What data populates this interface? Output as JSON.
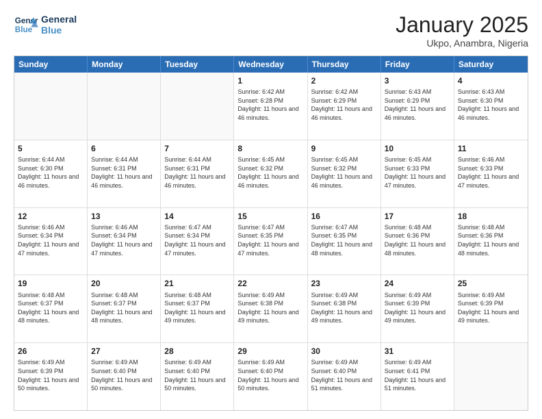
{
  "logo": {
    "line1": "General",
    "line2": "Blue"
  },
  "title": "January 2025",
  "location": "Ukpo, Anambra, Nigeria",
  "days": [
    "Sunday",
    "Monday",
    "Tuesday",
    "Wednesday",
    "Thursday",
    "Friday",
    "Saturday"
  ],
  "weeks": [
    [
      {
        "day": "",
        "info": ""
      },
      {
        "day": "",
        "info": ""
      },
      {
        "day": "",
        "info": ""
      },
      {
        "day": "1",
        "info": "Sunrise: 6:42 AM\nSunset: 6:28 PM\nDaylight: 11 hours and 46 minutes."
      },
      {
        "day": "2",
        "info": "Sunrise: 6:42 AM\nSunset: 6:29 PM\nDaylight: 11 hours and 46 minutes."
      },
      {
        "day": "3",
        "info": "Sunrise: 6:43 AM\nSunset: 6:29 PM\nDaylight: 11 hours and 46 minutes."
      },
      {
        "day": "4",
        "info": "Sunrise: 6:43 AM\nSunset: 6:30 PM\nDaylight: 11 hours and 46 minutes."
      }
    ],
    [
      {
        "day": "5",
        "info": "Sunrise: 6:44 AM\nSunset: 6:30 PM\nDaylight: 11 hours and 46 minutes."
      },
      {
        "day": "6",
        "info": "Sunrise: 6:44 AM\nSunset: 6:31 PM\nDaylight: 11 hours and 46 minutes."
      },
      {
        "day": "7",
        "info": "Sunrise: 6:44 AM\nSunset: 6:31 PM\nDaylight: 11 hours and 46 minutes."
      },
      {
        "day": "8",
        "info": "Sunrise: 6:45 AM\nSunset: 6:32 PM\nDaylight: 11 hours and 46 minutes."
      },
      {
        "day": "9",
        "info": "Sunrise: 6:45 AM\nSunset: 6:32 PM\nDaylight: 11 hours and 46 minutes."
      },
      {
        "day": "10",
        "info": "Sunrise: 6:45 AM\nSunset: 6:33 PM\nDaylight: 11 hours and 47 minutes."
      },
      {
        "day": "11",
        "info": "Sunrise: 6:46 AM\nSunset: 6:33 PM\nDaylight: 11 hours and 47 minutes."
      }
    ],
    [
      {
        "day": "12",
        "info": "Sunrise: 6:46 AM\nSunset: 6:34 PM\nDaylight: 11 hours and 47 minutes."
      },
      {
        "day": "13",
        "info": "Sunrise: 6:46 AM\nSunset: 6:34 PM\nDaylight: 11 hours and 47 minutes."
      },
      {
        "day": "14",
        "info": "Sunrise: 6:47 AM\nSunset: 6:34 PM\nDaylight: 11 hours and 47 minutes."
      },
      {
        "day": "15",
        "info": "Sunrise: 6:47 AM\nSunset: 6:35 PM\nDaylight: 11 hours and 47 minutes."
      },
      {
        "day": "16",
        "info": "Sunrise: 6:47 AM\nSunset: 6:35 PM\nDaylight: 11 hours and 48 minutes."
      },
      {
        "day": "17",
        "info": "Sunrise: 6:48 AM\nSunset: 6:36 PM\nDaylight: 11 hours and 48 minutes."
      },
      {
        "day": "18",
        "info": "Sunrise: 6:48 AM\nSunset: 6:36 PM\nDaylight: 11 hours and 48 minutes."
      }
    ],
    [
      {
        "day": "19",
        "info": "Sunrise: 6:48 AM\nSunset: 6:37 PM\nDaylight: 11 hours and 48 minutes."
      },
      {
        "day": "20",
        "info": "Sunrise: 6:48 AM\nSunset: 6:37 PM\nDaylight: 11 hours and 48 minutes."
      },
      {
        "day": "21",
        "info": "Sunrise: 6:48 AM\nSunset: 6:37 PM\nDaylight: 11 hours and 49 minutes."
      },
      {
        "day": "22",
        "info": "Sunrise: 6:49 AM\nSunset: 6:38 PM\nDaylight: 11 hours and 49 minutes."
      },
      {
        "day": "23",
        "info": "Sunrise: 6:49 AM\nSunset: 6:38 PM\nDaylight: 11 hours and 49 minutes."
      },
      {
        "day": "24",
        "info": "Sunrise: 6:49 AM\nSunset: 6:39 PM\nDaylight: 11 hours and 49 minutes."
      },
      {
        "day": "25",
        "info": "Sunrise: 6:49 AM\nSunset: 6:39 PM\nDaylight: 11 hours and 49 minutes."
      }
    ],
    [
      {
        "day": "26",
        "info": "Sunrise: 6:49 AM\nSunset: 6:39 PM\nDaylight: 11 hours and 50 minutes."
      },
      {
        "day": "27",
        "info": "Sunrise: 6:49 AM\nSunset: 6:40 PM\nDaylight: 11 hours and 50 minutes."
      },
      {
        "day": "28",
        "info": "Sunrise: 6:49 AM\nSunset: 6:40 PM\nDaylight: 11 hours and 50 minutes."
      },
      {
        "day": "29",
        "info": "Sunrise: 6:49 AM\nSunset: 6:40 PM\nDaylight: 11 hours and 50 minutes."
      },
      {
        "day": "30",
        "info": "Sunrise: 6:49 AM\nSunset: 6:40 PM\nDaylight: 11 hours and 51 minutes."
      },
      {
        "day": "31",
        "info": "Sunrise: 6:49 AM\nSunset: 6:41 PM\nDaylight: 11 hours and 51 minutes."
      },
      {
        "day": "",
        "info": ""
      }
    ]
  ]
}
